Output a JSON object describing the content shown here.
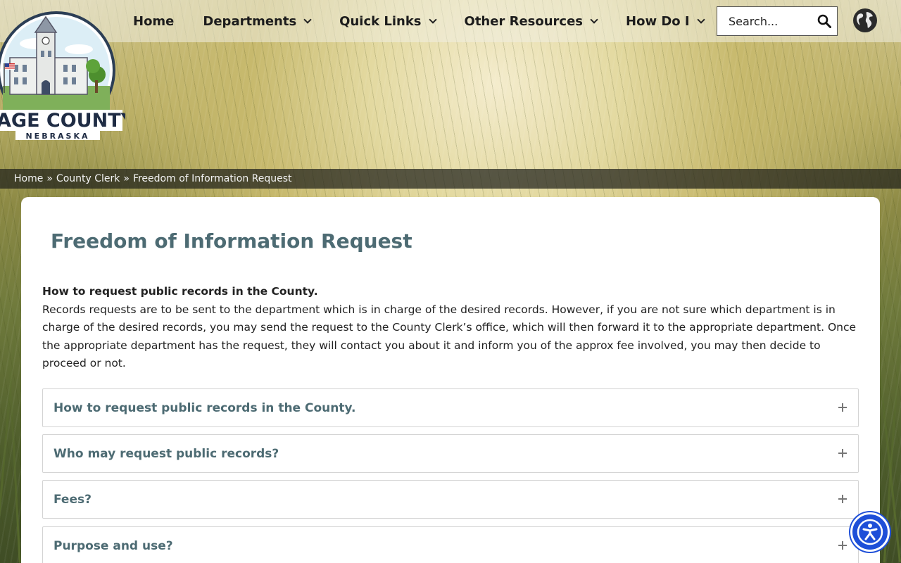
{
  "header": {
    "nav": [
      {
        "label": "Home",
        "dropdown": false
      },
      {
        "label": "Departments",
        "dropdown": true
      },
      {
        "label": "Quick Links",
        "dropdown": true
      },
      {
        "label": "Other Resources",
        "dropdown": true
      },
      {
        "label": "How Do I",
        "dropdown": true
      }
    ],
    "search": {
      "placeholder": "Search...",
      "icon": "search-icon"
    },
    "globe_icon": "globe-icon"
  },
  "logo": {
    "line1": "GAGE COUNTY",
    "line2": "NEBRASKA"
  },
  "breadcrumb": {
    "items": [
      "Home",
      "County Clerk",
      "Freedom of Information Request"
    ],
    "separator": "»"
  },
  "main": {
    "title": "Freedom of Information Request",
    "intro_heading": "How to request public records in the County.",
    "intro_text": "Records requests are to be sent to the department which is in charge of the desired records. However, if you are not sure which department is in charge of the desired records, you may send the request to the County Clerk’s office, which will then forward it to the appropriate department. Once the appropriate department has the request, they will contact you about it and inform you of the approx fee involved, you may then decide to proceed or not.",
    "accordion": [
      "How to request public records in the County.",
      "Who may request public records?",
      "Fees?",
      "Purpose and use?"
    ]
  },
  "colors": {
    "heading": "#4d6b73",
    "accessibility_button": "#1e4fd8"
  }
}
